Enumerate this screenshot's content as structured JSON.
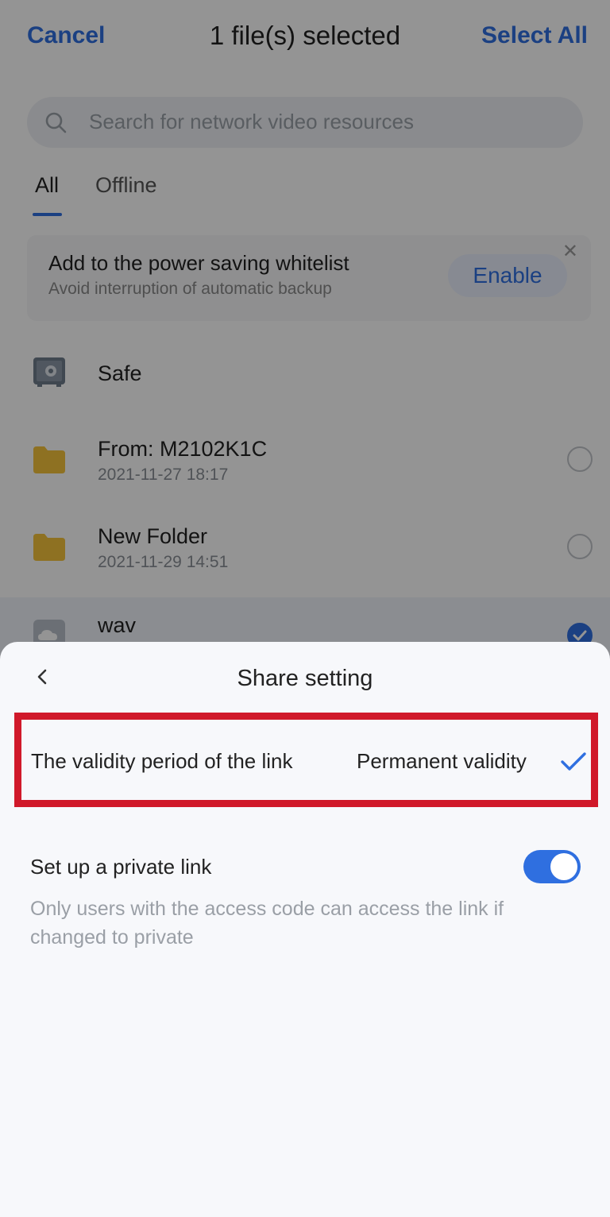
{
  "header": {
    "cancel_label": "Cancel",
    "title": "1 file(s) selected",
    "select_all_label": "Select All"
  },
  "search": {
    "placeholder": "Search for network video resources",
    "icon": "search-icon"
  },
  "tabs": [
    {
      "label": "All",
      "active": true
    },
    {
      "label": "Offline",
      "active": false
    }
  ],
  "banner": {
    "title": "Add to the power saving whitelist",
    "subtitle": "Avoid interruption of automatic backup",
    "button_label": "Enable",
    "close_icon": "close-icon"
  },
  "files": [
    {
      "name": "Safe",
      "date": "",
      "icon": "safe-icon",
      "selectable": false,
      "selected": false
    },
    {
      "name": "From: M2102K1C",
      "date": "2021-11-27  18:17",
      "icon": "folder-icon",
      "selectable": true,
      "selected": false
    },
    {
      "name": "New Folder",
      "date": "2021-11-29  14:51",
      "icon": "folder-icon",
      "selectable": true,
      "selected": false
    },
    {
      "name": "wav",
      "date": "",
      "icon": "cloud-folder-icon",
      "selectable": true,
      "selected": true
    }
  ],
  "sheet": {
    "title": "Share setting",
    "back_icon": "chevron-left-icon",
    "validity": {
      "label": "The validity period of the link",
      "value": "Permanent validity",
      "check_icon": "check-icon"
    },
    "private_link": {
      "title": "Set up a private link",
      "description": "Only users with the access code can access the link if changed to private",
      "enabled": true
    }
  },
  "colors": {
    "accent": "#2f6fe0",
    "highlight_border": "#d0192a",
    "folder": "#f5c33b"
  }
}
